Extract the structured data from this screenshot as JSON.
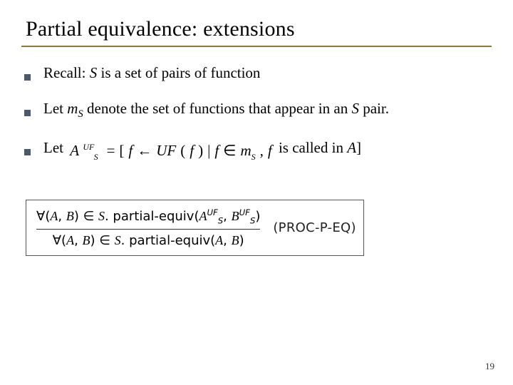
{
  "title": "Partial equivalence: extensions",
  "bullets": {
    "b1_pre": "Recall: ",
    "b1_var": "S",
    "b1_post": " is a set of pairs of function",
    "b2_pre": "Let ",
    "b2_m": "m",
    "b2_sub": "S",
    "b2_mid": " denote the set of functions that appear in an ",
    "b2_var": "S",
    "b2_post": " pair.",
    "b3_pre": "Let  ",
    "b3_formula": {
      "A": "A",
      "UF": "UF",
      "S": "S",
      "eq": "=",
      "lb": "[",
      "f1": "f",
      "arrow": "←",
      "UF2": "UF",
      "lp": "(",
      "f2": "f",
      "rp": ")",
      "bar": "|",
      "f3": "f",
      "in": "∈",
      "m": "m",
      "subS": "S",
      "comma": ",",
      "f4": "f"
    },
    "b3_mid": " is called in ",
    "b3_var": "A",
    "b3_post": "]"
  },
  "rule": {
    "top": {
      "forall": "∀",
      "lp": "(",
      "A": "A",
      "c1": ", ",
      "B": "B",
      "rp": ")",
      "in": " ∈ ",
      "S": "S",
      "dot": ".  ",
      "pe": "partial-equiv",
      "lp2": "(",
      "A2": "A",
      "UF": "UF",
      "subS": "S",
      "c2": ", ",
      "B2": "B",
      "UF2": "UF",
      "subS2": "S",
      "rp2": ")"
    },
    "bot": {
      "forall": "∀",
      "lp": "(",
      "A": "A",
      "c1": ", ",
      "B": "B",
      "rp": ")",
      "in": " ∈ ",
      "S": "S",
      "dot": ".  ",
      "pe": "partial-equiv",
      "lp2": "(",
      "A2": "A",
      "c2": ", ",
      "B2": "B",
      "rp2": ")"
    },
    "name": "(PROC-P-EQ)"
  },
  "page_number": "19"
}
